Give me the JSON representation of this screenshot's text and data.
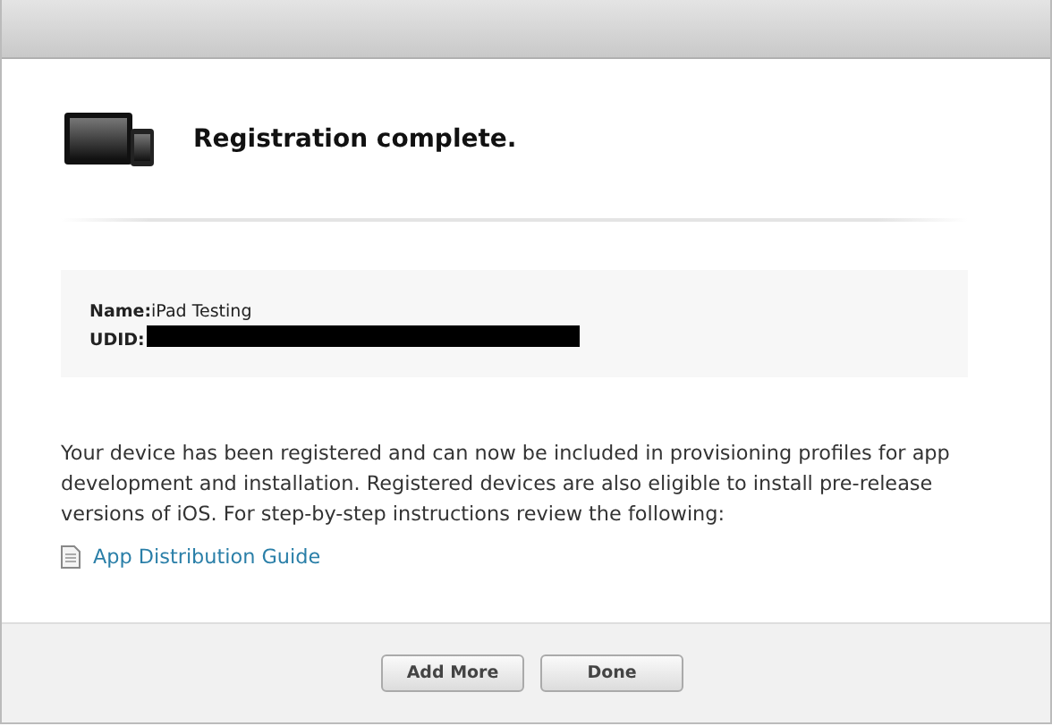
{
  "title": "Registration complete.",
  "device": {
    "name_label": "Name:",
    "name": "iPad Testing",
    "udid_label": "UDID:",
    "udid_redacted": true
  },
  "message": "Your device has been registered and can now be included in provisioning profiles for app development and installation. Registered devices are also eligible to install pre-release versions of iOS. For step-by-step instructions review the following:",
  "link": "App Distribution Guide",
  "buttons": [
    {
      "label": "Add More"
    },
    {
      "label": "Done"
    }
  ]
}
